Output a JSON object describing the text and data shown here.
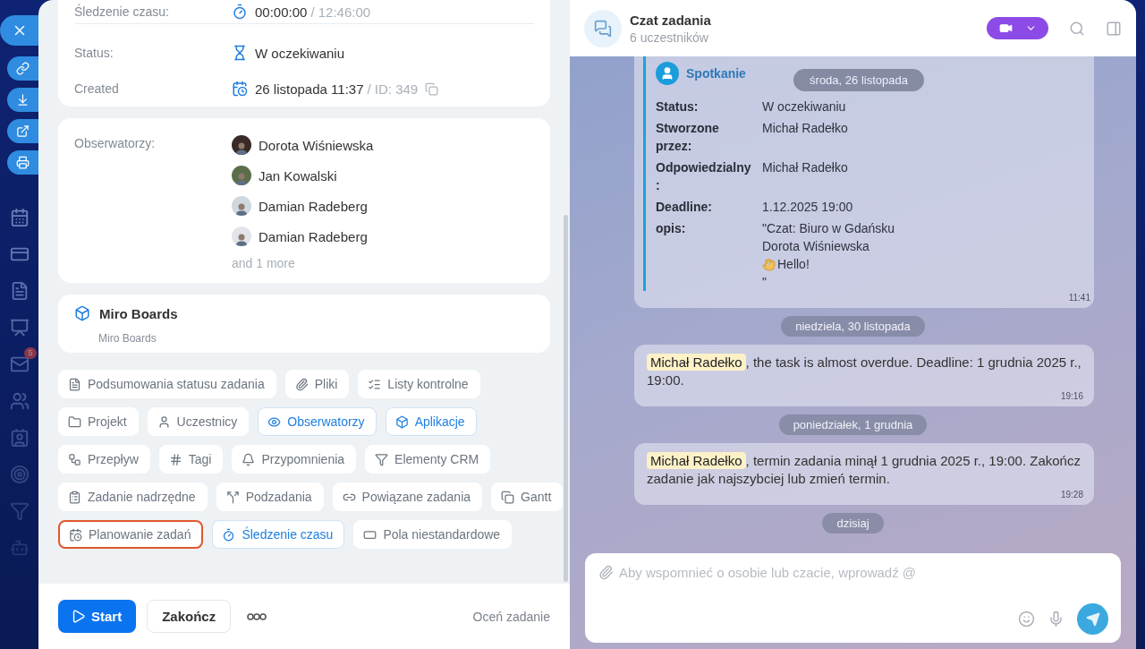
{
  "sidebar": {
    "badge": "5"
  },
  "task": {
    "fields": [
      {
        "kind": "timer",
        "label": "Śledzenie czasu:",
        "value": "00:00:00",
        "extra": "/ 12:46:00"
      },
      {
        "kind": "status",
        "label": "Status:",
        "value": "W oczekiwaniu"
      },
      {
        "kind": "created",
        "label": "Created",
        "value": "26 listopada 11:37",
        "extra": "/  ID: 349"
      }
    ],
    "observers": {
      "label": "Obserwatorzy:",
      "people": [
        {
          "name": "Dorota Wiśniewska"
        },
        {
          "name": "Jan Kowalski"
        },
        {
          "name": "Damian Radeberg"
        },
        {
          "name": "Damian Radeberg"
        }
      ],
      "more": "and 1 more"
    },
    "app": {
      "title": "Miro Boards",
      "subtitle": "Miro Boards"
    },
    "chip_rows": [
      [
        {
          "label": "Podsumowania statusu zadania",
          "active": false,
          "highlighted": false
        },
        {
          "label": "Pliki",
          "active": false,
          "highlighted": false
        },
        {
          "label": "Listy kontrolne",
          "active": false,
          "highlighted": false
        }
      ],
      [
        {
          "label": "Projekt",
          "active": false,
          "highlighted": false
        },
        {
          "label": "Uczestnicy",
          "active": false,
          "highlighted": false
        },
        {
          "label": "Obserwatorzy",
          "active": true,
          "highlighted": false
        },
        {
          "label": "Aplikacje",
          "active": true,
          "highlighted": false
        }
      ],
      [
        {
          "label": "Przepływ",
          "active": false,
          "highlighted": false
        },
        {
          "label": "Tagi",
          "active": false,
          "highlighted": false
        },
        {
          "label": "Przypomnienia",
          "active": false,
          "highlighted": false
        },
        {
          "label": "Elementy CRM",
          "active": false,
          "highlighted": false
        }
      ],
      [
        {
          "label": "Zadanie nadrzędne",
          "active": false,
          "highlighted": false
        },
        {
          "label": "Podzadania",
          "active": false,
          "highlighted": false
        },
        {
          "label": "Powiązane zadania",
          "active": false,
          "highlighted": false
        },
        {
          "label": "Gantt",
          "active": false,
          "highlighted": false
        }
      ],
      [
        {
          "label": "Planowanie zadań",
          "active": false,
          "highlighted": true
        },
        {
          "label": "Śledzenie czasu",
          "active": true,
          "highlighted": false
        },
        {
          "label": "Pola niestandardowe",
          "active": false,
          "highlighted": false
        }
      ]
    ],
    "footer": {
      "start": "Start",
      "finish": "Zakończ",
      "rate": "Oceń zadanie"
    }
  },
  "chat": {
    "title": "Czat zadania",
    "subtitle": "6 uczestników",
    "sticky_date": "środa, 26 listopada",
    "messages": [
      {
        "kind": "card",
        "title": "Spotkanie",
        "time": "11:41",
        "rows": [
          {
            "label": "Status:",
            "lines": [
              {
                "kind": "text",
                "text": "W oczekiwaniu"
              }
            ]
          },
          {
            "label": "Stworzone przez:",
            "lines": [
              {
                "kind": "text",
                "text": "Michał Radełko"
              }
            ]
          },
          {
            "label": "Odpowiedzialny :",
            "lines": [
              {
                "kind": "text",
                "text": "Michał Radełko"
              }
            ]
          },
          {
            "label": "Deadline:",
            "lines": [
              {
                "kind": "text",
                "text": "1.12.2025 19:00"
              }
            ]
          },
          {
            "label": "opis:",
            "lines": [
              {
                "kind": "text",
                "text": "\"Czat: Biuro w Gdańsku"
              },
              {
                "kind": "text",
                "text": "Dorota Wiśniewska"
              },
              {
                "kind": "greeting",
                "text": "Hello!"
              },
              {
                "kind": "text",
                "text": "\""
              }
            ]
          }
        ]
      },
      {
        "kind": "date",
        "text": "niedziela, 30 listopada"
      },
      {
        "kind": "system",
        "mention": "Michał Radełko",
        "text": ", the task is almost overdue. Deadline: 1 grudnia 2025 r., 19:00.",
        "time": "19:16"
      },
      {
        "kind": "date",
        "text": "poniedziałek, 1 grudnia"
      },
      {
        "kind": "system",
        "mention": "Michał Radełko",
        "text": ", termin zadania minął 1 grudnia 2025 r., 19:00. Zakończ zadanie jak najszybciej lub zmień termin.",
        "time": "19:28"
      },
      {
        "kind": "date",
        "text": "dzisiaj"
      }
    ],
    "composer": {
      "placeholder": "Aby wspomnieć o osobie lub czacie, wprowadź @"
    }
  }
}
